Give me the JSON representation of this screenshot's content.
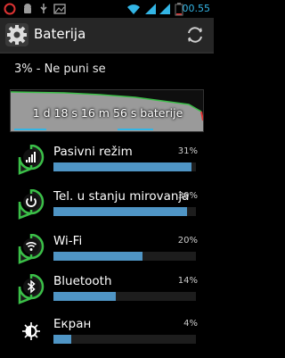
{
  "status_bar": {
    "time": "00.55"
  },
  "app": {
    "title": "Baterija"
  },
  "battery": {
    "summary": "3% - Ne puni se",
    "level": 0.03,
    "graph_label": "1 d 18 s 16 m 56 s baterije"
  },
  "usage": [
    {
      "label": "Pasivni režim",
      "percent_text": "31%",
      "percent": 31,
      "icon": "signal-icon"
    },
    {
      "label": "Tel. u stanju mirovanja",
      "percent_text": "30%",
      "percent": 30,
      "icon": "power-icon"
    },
    {
      "label": "Wi-Fi",
      "percent_text": "20%",
      "percent": 20,
      "icon": "wifi-icon"
    },
    {
      "label": "Bluetooth",
      "percent_text": "14%",
      "percent": 14,
      "icon": "bluetooth-icon"
    },
    {
      "label": "Екран",
      "percent_text": "4%",
      "percent": 4,
      "icon": "brightness-icon"
    }
  ],
  "colors": {
    "accent": "#33b5e5",
    "bar": "#4f95c5",
    "ring": "#3bbf48",
    "graph_fill": "#9a9a9a"
  }
}
